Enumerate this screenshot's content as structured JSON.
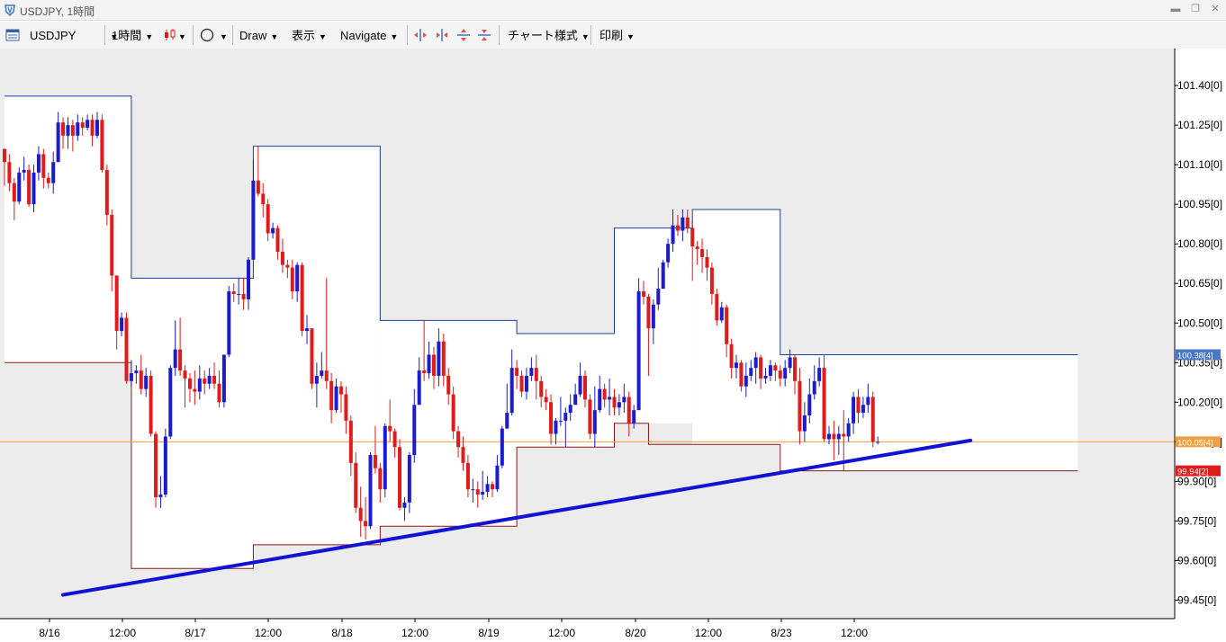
{
  "window": {
    "title": "USDJPY, 1時間"
  },
  "toolbar": {
    "symbol": "USDJPY",
    "timeframe": "1時間",
    "draw": "Draw",
    "view": "表示",
    "navigate": "Navigate",
    "chart_style": "チャート様式",
    "print": "印刷"
  },
  "colors": {
    "up": "#1c1ccd",
    "down": "#e01b1b",
    "resistance": "#1e3f9a",
    "support": "#8b1a1a",
    "trendline": "#1212d6",
    "current_price_line": "#f0a040",
    "background_shade": "#ececec"
  },
  "chart_data": {
    "type": "candlestick",
    "symbol": "USDJPY",
    "ylim": [
      99.38,
      101.54
    ],
    "y_ticks": [
      "101.40[0]",
      "101.25[0]",
      "101.10[0]",
      "100.95[0]",
      "100.80[0]",
      "100.65[0]",
      "100.50[0]",
      "100.35[0]",
      "100.20[0]",
      "100.05[0]",
      "99.90[0]",
      "99.75[0]",
      "99.60[0]",
      "99.45[0]"
    ],
    "x_labels": [
      "8/16",
      "12:00",
      "8/17",
      "12:00",
      "8/18",
      "12:00",
      "8/19",
      "12:00",
      "8/20",
      "12:00",
      "8/23",
      "12:00"
    ],
    "price_tags": [
      {
        "label": "100.38[4]",
        "value": 100.38,
        "color": "#4a78c8"
      },
      {
        "label": "100.05[4]",
        "value": 100.05,
        "color": "#f0a040"
      },
      {
        "label": "99.94[2]",
        "value": 99.94,
        "color": "#e01b1b"
      }
    ],
    "current_price": 100.05,
    "trendline": {
      "start": {
        "index": 12,
        "price": 99.47
      },
      "end": {
        "index": 198,
        "price": 100.055
      }
    },
    "resistance_steps": [
      [
        0,
        101.36
      ],
      [
        26,
        100.67
      ],
      [
        51,
        101.17
      ],
      [
        77,
        100.51
      ],
      [
        105,
        100.46
      ],
      [
        125,
        100.86
      ],
      [
        141,
        100.93
      ],
      [
        159,
        100.38
      ],
      [
        220,
        100.38
      ]
    ],
    "support_steps": [
      [
        0,
        100.35
      ],
      [
        26,
        99.57
      ],
      [
        51,
        99.66
      ],
      [
        77,
        99.73
      ],
      [
        105,
        100.03
      ],
      [
        125,
        100.12
      ],
      [
        132,
        100.04
      ],
      [
        159,
        99.94
      ],
      [
        220,
        99.94
      ]
    ],
    "candles": [
      [
        101.16,
        101.11,
        101.16,
        101.02
      ],
      [
        101.11,
        101.03,
        101.14,
        101.0
      ],
      [
        101.03,
        100.96,
        101.05,
        100.89
      ],
      [
        100.96,
        101.07,
        101.09,
        100.95
      ],
      [
        101.07,
        101.08,
        101.13,
        101.04
      ],
      [
        101.08,
        100.95,
        101.1,
        100.94
      ],
      [
        100.95,
        101.07,
        101.1,
        100.92
      ],
      [
        101.07,
        101.14,
        101.17,
        101.04
      ],
      [
        101.14,
        101.05,
        101.16,
        101.01
      ],
      [
        101.05,
        101.03,
        101.07,
        101.01
      ],
      [
        101.03,
        101.11,
        101.15,
        100.99
      ],
      [
        101.11,
        101.26,
        101.3,
        101.11
      ],
      [
        101.26,
        101.21,
        101.28,
        101.16
      ],
      [
        101.21,
        101.25,
        101.28,
        101.16
      ],
      [
        101.25,
        101.21,
        101.27,
        101.15
      ],
      [
        101.21,
        101.26,
        101.29,
        101.19
      ],
      [
        101.26,
        101.24,
        101.28,
        101.21
      ],
      [
        101.24,
        101.27,
        101.29,
        101.23
      ],
      [
        101.27,
        101.21,
        101.29,
        101.17
      ],
      [
        101.21,
        101.27,
        101.3,
        101.2
      ],
      [
        101.27,
        101.08,
        101.29,
        101.07
      ],
      [
        101.08,
        100.91,
        101.1,
        100.87
      ],
      [
        100.91,
        100.68,
        100.93,
        100.62
      ],
      [
        100.68,
        100.47,
        100.68,
        100.4
      ],
      [
        100.47,
        100.52,
        100.54,
        100.45
      ],
      [
        100.52,
        100.28,
        100.54,
        100.27
      ],
      [
        100.28,
        100.31,
        100.36,
        100.26
      ],
      [
        100.31,
        100.32,
        100.34,
        100.27
      ],
      [
        100.32,
        100.25,
        100.38,
        100.23
      ],
      [
        100.25,
        100.3,
        100.33,
        100.22
      ],
      [
        100.3,
        100.08,
        100.32,
        100.07
      ],
      [
        100.08,
        99.84,
        100.09,
        99.8
      ],
      [
        99.84,
        99.85,
        99.92,
        99.8
      ],
      [
        99.85,
        100.07,
        100.1,
        99.84
      ],
      [
        100.07,
        100.33,
        100.34,
        100.06
      ],
      [
        100.33,
        100.4,
        100.51,
        100.3
      ],
      [
        100.4,
        100.32,
        100.52,
        100.3
      ],
      [
        100.32,
        100.29,
        100.34,
        100.18
      ],
      [
        100.29,
        100.25,
        100.31,
        100.2
      ],
      [
        100.25,
        100.24,
        100.32,
        100.19
      ],
      [
        100.24,
        100.29,
        100.34,
        100.21
      ],
      [
        100.29,
        100.27,
        100.32,
        100.23
      ],
      [
        100.27,
        100.3,
        100.33,
        100.25
      ],
      [
        100.3,
        100.27,
        100.35,
        100.25
      ],
      [
        100.27,
        100.2,
        100.32,
        100.18
      ],
      [
        100.2,
        100.38,
        100.38,
        100.18
      ],
      [
        100.38,
        100.62,
        100.64,
        100.37
      ],
      [
        100.62,
        100.61,
        100.65,
        100.58
      ],
      [
        100.61,
        100.61,
        100.67,
        100.57
      ],
      [
        100.61,
        100.59,
        100.67,
        100.55
      ],
      [
        100.59,
        100.74,
        100.75,
        100.55
      ],
      [
        100.74,
        101.04,
        101.12,
        100.74
      ],
      [
        101.04,
        100.99,
        101.17,
        100.98
      ],
      [
        100.99,
        100.95,
        101.03,
        100.9
      ],
      [
        100.95,
        100.84,
        100.97,
        100.81
      ],
      [
        100.84,
        100.86,
        100.88,
        100.82
      ],
      [
        100.86,
        100.77,
        100.87,
        100.74
      ],
      [
        100.77,
        100.72,
        100.82,
        100.69
      ],
      [
        100.72,
        100.71,
        100.74,
        100.67
      ],
      [
        100.71,
        100.62,
        100.74,
        100.59
      ],
      [
        100.62,
        100.72,
        100.73,
        100.58
      ],
      [
        100.72,
        100.47,
        100.73,
        100.45
      ],
      [
        100.47,
        100.48,
        100.53,
        100.42
      ],
      [
        100.48,
        100.27,
        100.48,
        100.25
      ],
      [
        100.27,
        100.3,
        100.35,
        100.18
      ],
      [
        100.3,
        100.32,
        100.39,
        100.29
      ],
      [
        100.32,
        100.28,
        100.67,
        100.25
      ],
      [
        100.28,
        100.17,
        100.31,
        100.12
      ],
      [
        100.17,
        100.26,
        100.29,
        100.16
      ],
      [
        100.26,
        100.23,
        100.28,
        100.16
      ],
      [
        100.23,
        100.13,
        100.26,
        100.08
      ],
      [
        100.13,
        99.97,
        100.15,
        99.92
      ],
      [
        99.97,
        99.8,
        100.01,
        99.78
      ],
      [
        99.8,
        99.75,
        99.88,
        99.69
      ],
      [
        99.75,
        99.73,
        99.84,
        99.68
      ],
      [
        99.73,
        100.0,
        100.01,
        99.72
      ],
      [
        100.0,
        99.95,
        100.11,
        99.93
      ],
      [
        99.95,
        99.87,
        99.97,
        99.82
      ],
      [
        99.87,
        100.11,
        100.12,
        99.84
      ],
      [
        100.11,
        100.09,
        100.21,
        100.05
      ],
      [
        100.09,
        100.03,
        100.1,
        99.99
      ],
      [
        100.03,
        99.8,
        100.06,
        99.79
      ],
      [
        99.8,
        99.82,
        99.84,
        99.75
      ],
      [
        99.82,
        100.0,
        100.01,
        99.78
      ],
      [
        100.0,
        100.19,
        100.25,
        99.97
      ],
      [
        100.19,
        100.32,
        100.37,
        100.19
      ],
      [
        100.32,
        100.31,
        100.51,
        100.28
      ],
      [
        100.31,
        100.38,
        100.43,
        100.29
      ],
      [
        100.38,
        100.3,
        100.41,
        100.25
      ],
      [
        100.3,
        100.43,
        100.48,
        100.26
      ],
      [
        100.43,
        100.3,
        100.46,
        100.26
      ],
      [
        100.3,
        100.23,
        100.33,
        100.19
      ],
      [
        100.23,
        100.09,
        100.26,
        100.06
      ],
      [
        100.09,
        100.03,
        100.11,
        99.99
      ],
      [
        100.03,
        99.97,
        100.07,
        99.94
      ],
      [
        99.97,
        99.87,
        100.0,
        99.84
      ],
      [
        99.87,
        99.87,
        99.91,
        99.82
      ],
      [
        99.87,
        99.85,
        99.9,
        99.8
      ],
      [
        99.85,
        99.86,
        99.94,
        99.83
      ],
      [
        99.86,
        99.89,
        99.92,
        99.84
      ],
      [
        99.89,
        99.87,
        99.9,
        99.84
      ],
      [
        99.87,
        99.96,
        100.0,
        99.86
      ],
      [
        99.96,
        100.1,
        100.11,
        99.95
      ],
      [
        100.1,
        100.16,
        100.27,
        100.12
      ],
      [
        100.16,
        100.33,
        100.4,
        100.15
      ],
      [
        100.33,
        100.3,
        100.36,
        100.25
      ],
      [
        100.3,
        100.24,
        100.32,
        100.22
      ],
      [
        100.24,
        100.3,
        100.33,
        100.21
      ],
      [
        100.3,
        100.33,
        100.37,
        100.28
      ],
      [
        100.33,
        100.28,
        100.38,
        100.21
      ],
      [
        100.28,
        100.22,
        100.3,
        100.18
      ],
      [
        100.22,
        100.2,
        100.25,
        100.17
      ],
      [
        100.2,
        100.08,
        100.23,
        100.04
      ],
      [
        100.08,
        100.13,
        100.14,
        100.04
      ],
      [
        100.13,
        100.13,
        100.22,
        100.11
      ],
      [
        100.13,
        100.16,
        100.18,
        100.03
      ],
      [
        100.16,
        100.19,
        100.23,
        100.13
      ],
      [
        100.19,
        100.23,
        100.27,
        100.2
      ],
      [
        100.23,
        100.3,
        100.35,
        100.22
      ],
      [
        100.3,
        100.21,
        100.32,
        100.18
      ],
      [
        100.21,
        100.08,
        100.23,
        100.06
      ],
      [
        100.08,
        100.17,
        100.26,
        100.03
      ],
      [
        100.17,
        100.25,
        100.3,
        100.16
      ],
      [
        100.25,
        100.21,
        100.27,
        100.18
      ],
      [
        100.21,
        100.22,
        100.29,
        100.15
      ],
      [
        100.22,
        100.18,
        100.25,
        100.15
      ],
      [
        100.18,
        100.2,
        100.23,
        100.15
      ],
      [
        100.2,
        100.22,
        100.27,
        100.16
      ],
      [
        100.22,
        100.12,
        100.24,
        100.07
      ],
      [
        100.12,
        100.17,
        100.19,
        100.1
      ],
      [
        100.17,
        100.62,
        100.67,
        100.45
      ],
      [
        100.62,
        100.6,
        100.66,
        100.57
      ],
      [
        100.6,
        100.48,
        100.61,
        100.3
      ],
      [
        100.48,
        100.57,
        100.59,
        100.42
      ],
      [
        100.57,
        100.63,
        100.71,
        100.55
      ],
      [
        100.63,
        100.73,
        100.74,
        100.63
      ],
      [
        100.73,
        100.8,
        100.82,
        100.71
      ],
      [
        100.8,
        100.87,
        100.93,
        100.77
      ],
      [
        100.87,
        100.85,
        100.91,
        100.83
      ],
      [
        100.85,
        100.9,
        100.93,
        100.81
      ],
      [
        100.9,
        100.86,
        100.93,
        100.84
      ],
      [
        100.86,
        100.79,
        100.89,
        100.66
      ],
      [
        100.79,
        100.78,
        100.81,
        100.72
      ],
      [
        100.78,
        100.75,
        100.82,
        100.69
      ],
      [
        100.75,
        100.71,
        100.78,
        100.66
      ],
      [
        100.71,
        100.61,
        100.73,
        100.57
      ],
      [
        100.61,
        100.51,
        100.63,
        100.49
      ],
      [
        100.51,
        100.56,
        100.58,
        100.5
      ],
      [
        100.56,
        100.42,
        100.57,
        100.37
      ],
      [
        100.42,
        100.33,
        100.44,
        100.29
      ],
      [
        100.33,
        100.35,
        100.38,
        100.29
      ],
      [
        100.35,
        100.26,
        100.36,
        100.24
      ],
      [
        100.26,
        100.3,
        100.35,
        100.22
      ],
      [
        100.3,
        100.33,
        100.36,
        100.28
      ],
      [
        100.33,
        100.37,
        100.39,
        100.27
      ],
      [
        100.37,
        100.29,
        100.38,
        100.25
      ],
      [
        100.29,
        100.3,
        100.33,
        100.27
      ],
      [
        100.3,
        100.34,
        100.36,
        100.28
      ],
      [
        100.34,
        100.32,
        100.35,
        100.28
      ],
      [
        100.32,
        100.29,
        100.34,
        100.26
      ],
      [
        100.29,
        100.33,
        100.36,
        100.26
      ],
      [
        100.33,
        100.37,
        100.4,
        100.31
      ],
      [
        100.37,
        100.28,
        100.38,
        100.23
      ],
      [
        100.28,
        100.09,
        100.33,
        100.04
      ],
      [
        100.09,
        100.15,
        100.2,
        100.05
      ],
      [
        100.15,
        100.23,
        100.29,
        100.12
      ],
      [
        100.23,
        100.28,
        100.34,
        100.21
      ],
      [
        100.28,
        100.33,
        100.37,
        100.26
      ],
      [
        100.33,
        100.06,
        100.38,
        100.05
      ],
      [
        100.06,
        100.08,
        100.11,
        100.04
      ],
      [
        100.08,
        100.06,
        100.13,
        99.98
      ],
      [
        100.06,
        100.08,
        100.11,
        100.0
      ],
      [
        100.08,
        100.07,
        100.17,
        99.94
      ],
      [
        100.07,
        100.12,
        100.14,
        100.05
      ],
      [
        100.12,
        100.22,
        100.24,
        100.08
      ],
      [
        100.22,
        100.16,
        100.25,
        100.12
      ],
      [
        100.16,
        100.19,
        100.22,
        100.14
      ],
      [
        100.19,
        100.22,
        100.27,
        100.16
      ],
      [
        100.22,
        100.05,
        100.24,
        100.03
      ],
      [
        100.05,
        100.05,
        100.07,
        100.04
      ]
    ]
  }
}
